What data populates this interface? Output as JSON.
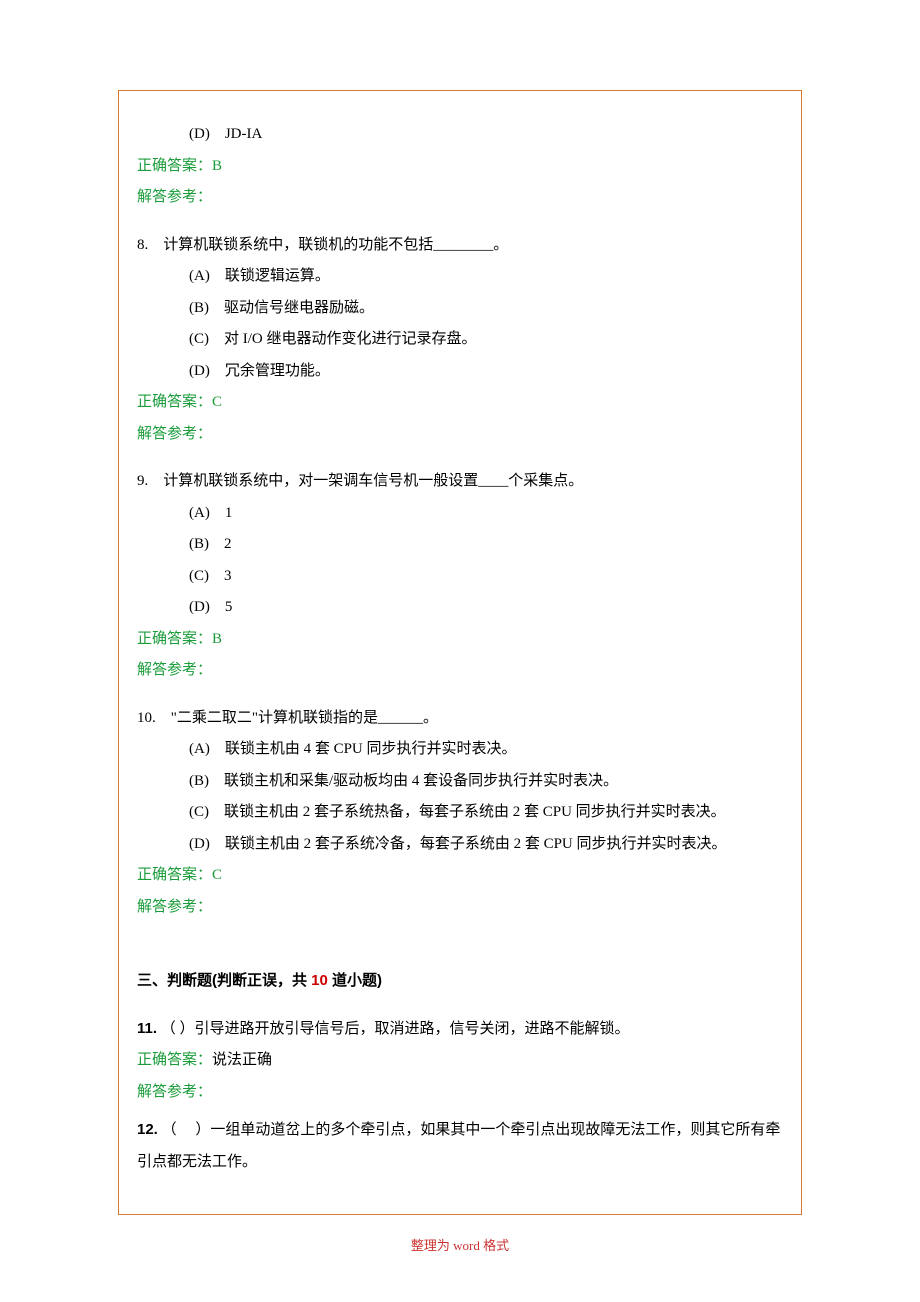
{
  "q7": {
    "optD": "(D)　JD-IA",
    "answer": "正确答案：B",
    "ref": "解答参考："
  },
  "q8": {
    "stem": "8.　计算机联锁系统中，联锁机的功能不包括________。",
    "optA": "(A)　联锁逻辑运算。",
    "optB": "(B)　驱动信号继电器励磁。",
    "optC": "(C)　对 I/O 继电器动作变化进行记录存盘。",
    "optD": "(D)　冗余管理功能。",
    "answer": "正确答案：C",
    "ref": "解答参考："
  },
  "q9": {
    "stem": "9.　计算机联锁系统中，对一架调车信号机一般设置____个采集点。",
    "optA": "(A)　1",
    "optB": "(B)　2",
    "optC": "(C)　3",
    "optD": "(D)　5",
    "answer": "正确答案：B",
    "ref": "解答参考："
  },
  "q10": {
    "stem": "10.　\"二乘二取二\"计算机联锁指的是______。",
    "optA": "(A)　联锁主机由 4 套 CPU 同步执行并实时表决。",
    "optB": "(B)　联锁主机和采集/驱动板均由 4 套设备同步执行并实时表决。",
    "optC": "(C)　联锁主机由 2 套子系统热备，每套子系统由 2 套 CPU 同步执行并实时表决。",
    "optD": "(D)　联锁主机由 2 套子系统冷备，每套子系统由 2 套 CPU 同步执行并实时表决。",
    "answer": "正确答案：C",
    "ref": "解答参考："
  },
  "section3": {
    "title_pre": "三、判断题(判断正误，共 ",
    "count": "10",
    "title_post": " 道小题)"
  },
  "q11": {
    "num": "11.",
    "stem": "（ ）引导进路开放引导信号后，取消进路，信号关闭，进路不能解锁。",
    "answer_label": "正确答案：",
    "answer_val": "说法正确",
    "ref": "解答参考："
  },
  "q12": {
    "num": "12.",
    "stem": "（　 ）一组单动道岔上的多个牵引点，如果其中一个牵引点出现故障无法工作，则其它所有牵引点都无法工作。"
  },
  "footer": "整理为 word 格式"
}
